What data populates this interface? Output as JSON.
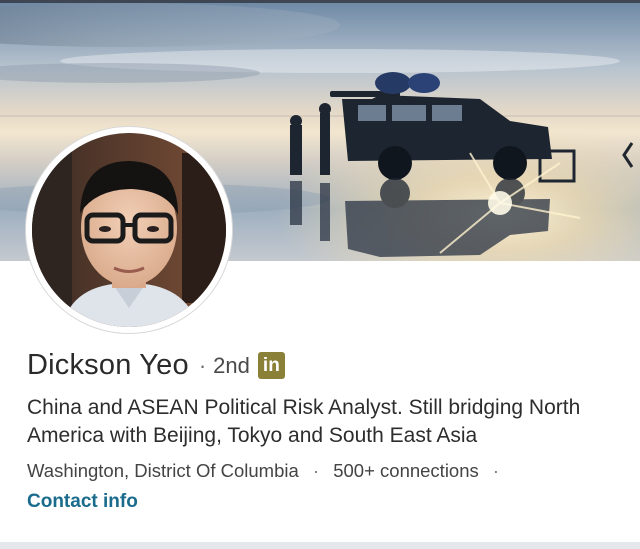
{
  "profile": {
    "name": "Dickson Yeo",
    "separator": "·",
    "degree": "2nd",
    "badge": "in",
    "headline": "China and ASEAN Political Risk Analyst. Still bridging North America with Beijing, Tokyo and South East Asia",
    "location": "Washington, District Of Columbia",
    "dot": "·",
    "connections": "500+ connections",
    "trailing_dot": "·",
    "contact_label": "Contact info"
  },
  "colors": {
    "badge_bg": "#8a8038",
    "link": "#1a6b8c",
    "name": "#2a2a2a"
  },
  "icons": {
    "badge": "linkedin-icon"
  }
}
